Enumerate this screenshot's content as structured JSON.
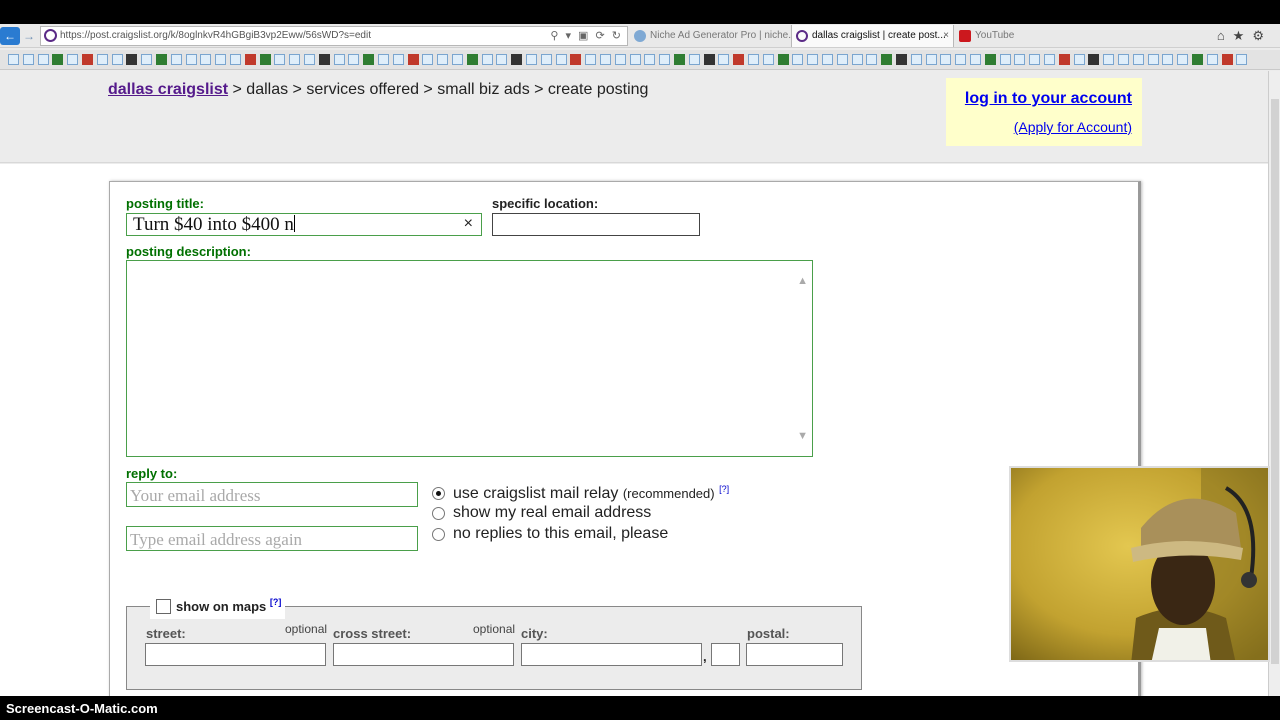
{
  "browser": {
    "url": "https://post.craigslist.org/k/8oglnkvR4hGBgiB3vp2Eww/56sWD?s=edit",
    "tabs": [
      {
        "title": "Niche Ad Generator Pro | niche...",
        "active": false
      },
      {
        "title": "dallas craigslist | create post...",
        "active": true
      },
      {
        "title": "YouTube",
        "active": false
      }
    ],
    "tab_close": "×"
  },
  "breadcrumb": {
    "site": "dallas craigslist",
    "trail": " > dallas > services offered > small biz ads > create posting"
  },
  "account": {
    "login": "log in to your account",
    "apply": "(Apply for Account)"
  },
  "form": {
    "posting_title_label": "posting title:",
    "posting_title_value": "Turn $40 into $400 n",
    "clear": "×",
    "specific_location_label": "specific location:",
    "specific_location_value": "",
    "posting_description_label": "posting description:",
    "posting_description_value": "",
    "reply_to_label": "reply to:",
    "email_placeholder": "Your email address",
    "email_again_placeholder": "Type email address again",
    "reply_options": [
      {
        "label": "use craigslist mail relay",
        "note": "(recommended)",
        "help": "[?]",
        "selected": true
      },
      {
        "label": "show my real email address",
        "selected": false
      },
      {
        "label": "no replies to this email, please",
        "selected": false
      }
    ],
    "map": {
      "label": "show on maps",
      "help": "[?]",
      "street_label": "street:",
      "cross_street_label": "cross street:",
      "city_label": "city:",
      "postal_label": "postal:",
      "optional": "optional",
      "comma": ","
    }
  },
  "footer": {
    "brand": "Screencast-O-Matic.com"
  }
}
